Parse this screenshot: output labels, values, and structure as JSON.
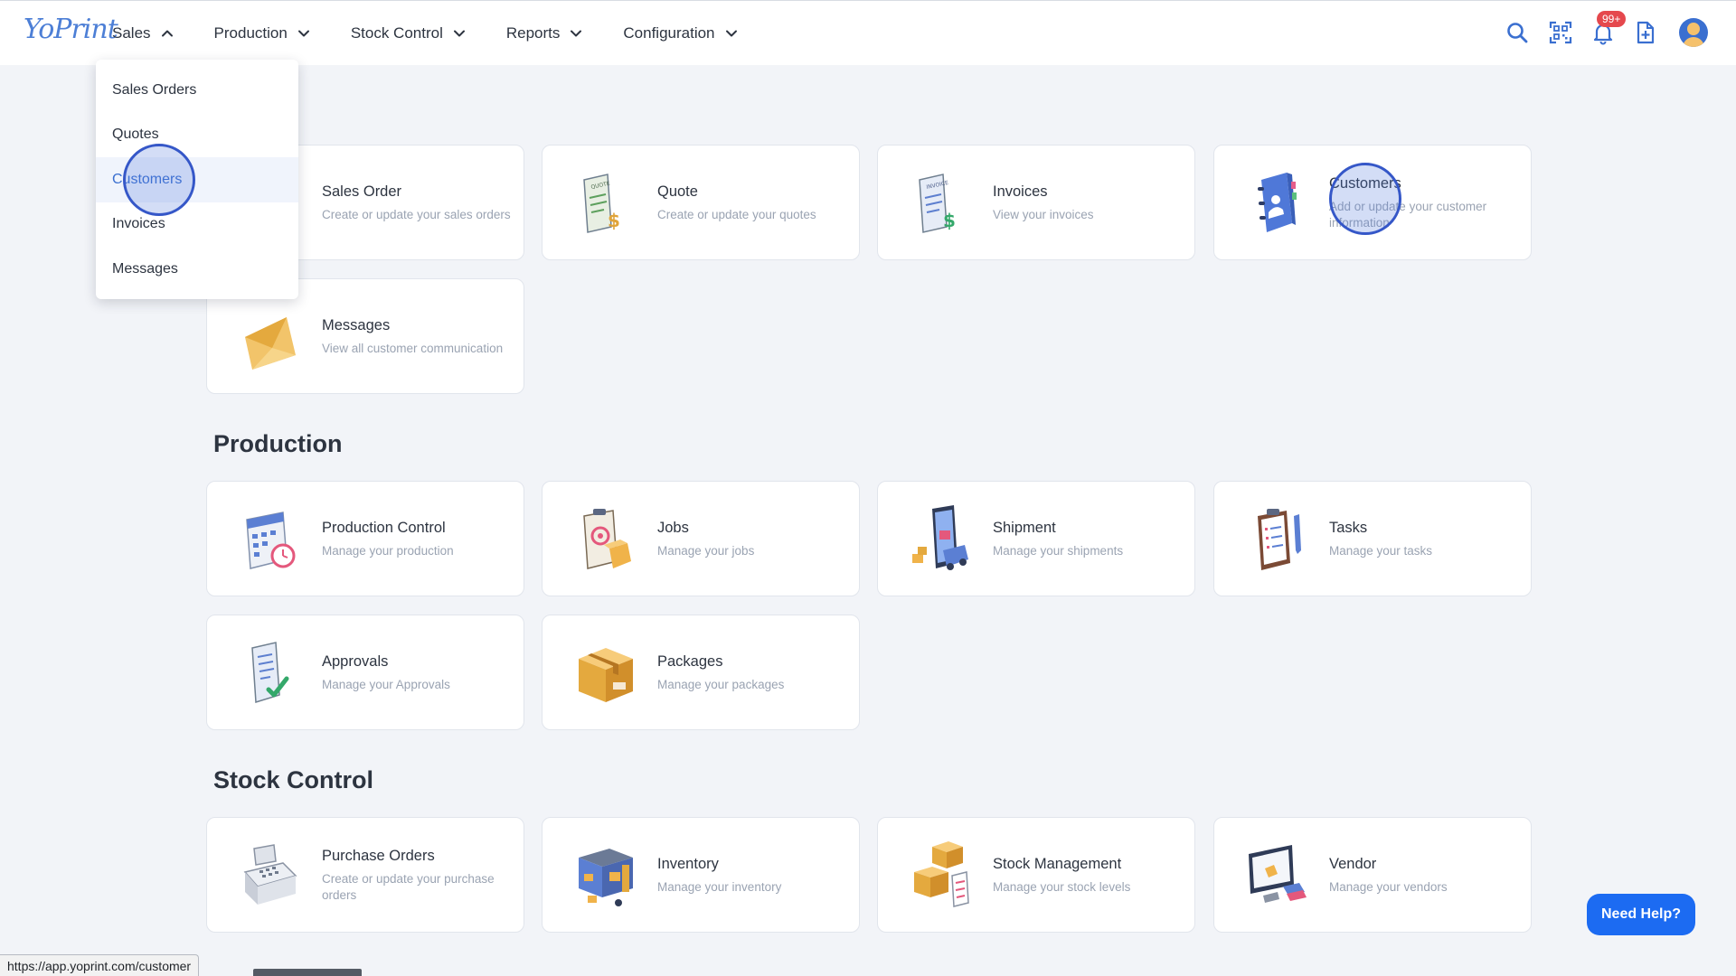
{
  "app": {
    "logo_text": "YoPrint"
  },
  "nav": {
    "items": [
      {
        "label": "Sales",
        "expanded": true
      },
      {
        "label": "Production",
        "expanded": false
      },
      {
        "label": "Stock Control",
        "expanded": false
      },
      {
        "label": "Reports",
        "expanded": false
      },
      {
        "label": "Configuration",
        "expanded": false
      }
    ]
  },
  "header_icons": {
    "search": "search-icon",
    "scan": "qr-scan-icon",
    "notifications": "bell-icon",
    "notification_badge": "99+",
    "new_document": "add-document-icon",
    "avatar": "user-avatar"
  },
  "dropdown": {
    "items": [
      {
        "label": "Sales Orders",
        "active": false
      },
      {
        "label": "Quotes",
        "active": false
      },
      {
        "label": "Customers",
        "active": true
      },
      {
        "label": "Invoices",
        "active": false
      },
      {
        "label": "Messages",
        "active": false
      }
    ]
  },
  "sections": {
    "production_title": "Production",
    "stock_title": "Stock Control"
  },
  "cards": {
    "sales_order": {
      "title": "Sales Order",
      "desc": "Create or update your sales orders"
    },
    "quote": {
      "title": "Quote",
      "desc": "Create or update your quotes"
    },
    "invoices": {
      "title": "Invoices",
      "desc": "View your invoices"
    },
    "customers": {
      "title": "Customers",
      "desc": "Add or update your customer information"
    },
    "messages": {
      "title": "Messages",
      "desc": "View all customer communication"
    },
    "production_control": {
      "title": "Production Control",
      "desc": "Manage your production"
    },
    "jobs": {
      "title": "Jobs",
      "desc": "Manage your jobs"
    },
    "shipment": {
      "title": "Shipment",
      "desc": "Manage your shipments"
    },
    "tasks": {
      "title": "Tasks",
      "desc": "Manage your tasks"
    },
    "approvals": {
      "title": "Approvals",
      "desc": "Manage your Approvals"
    },
    "packages": {
      "title": "Packages",
      "desc": "Manage your packages"
    },
    "purchase_orders": {
      "title": "Purchase Orders",
      "desc": "Create or update your purchase orders"
    },
    "inventory": {
      "title": "Inventory",
      "desc": "Manage your inventory"
    },
    "stock_management": {
      "title": "Stock Management",
      "desc": "Manage your stock levels"
    },
    "vendor": {
      "title": "Vendor",
      "desc": "Manage your vendors"
    }
  },
  "help_button": "Need Help?",
  "status_url": "https://app.yoprint.com/customer",
  "colors": {
    "accent": "#3a6fd0",
    "help_button": "#1c6bf2",
    "badge": "#e5484d",
    "background": "#f2f4f8"
  }
}
